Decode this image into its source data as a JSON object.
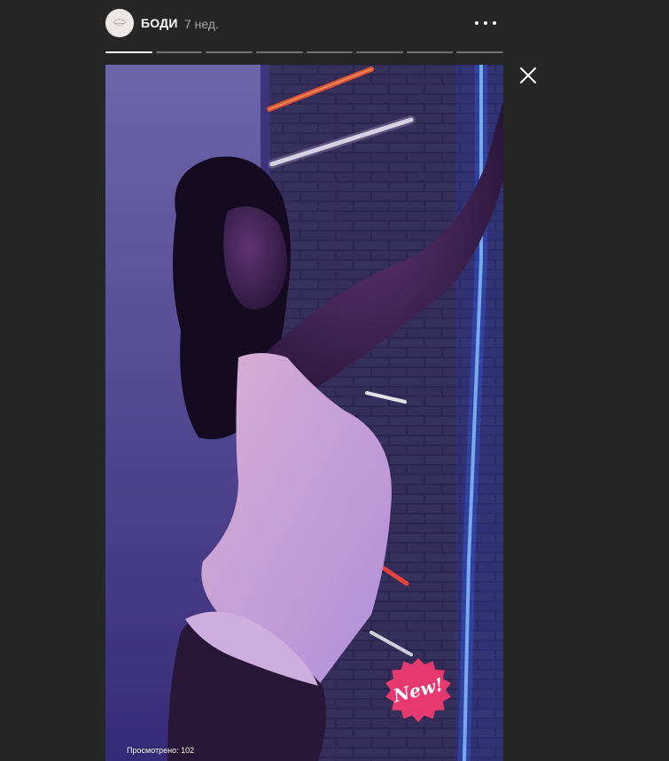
{
  "story": {
    "username": "БОДИ",
    "posted_ago": "7 нед.",
    "avatar_icon": "brand-logo-avatar",
    "segments": [
      {
        "progress": 1.0
      },
      {
        "progress": 0.0
      },
      {
        "progress": 0.0
      },
      {
        "progress": 0.0
      },
      {
        "progress": 0.0
      },
      {
        "progress": 0.0
      },
      {
        "progress": 0.0
      },
      {
        "progress": 0.0
      }
    ],
    "more_icon": "more-horizontal-icon",
    "close_icon": "close-icon",
    "views_label": "Просмотрено: 102",
    "sticker_text": "New!",
    "colors": {
      "background": "#262626",
      "sticker": "#e6396f",
      "neon_blue": "#3d6bff",
      "neon_red": "#ff3a2a"
    }
  }
}
